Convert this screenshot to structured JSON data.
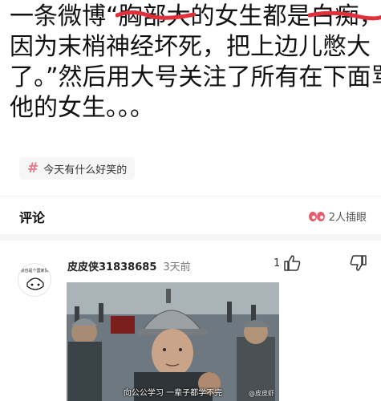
{
  "post": {
    "lines": [
      {
        "before": "一条微博“",
        "struck": "胸部大",
        "after": "的女生都是",
        "struck2": "白痴",
        "after2": "，"
      },
      {
        "text": "因为末梢神经坏死，把上边儿憋大"
      },
      {
        "text": "了。”然后用大号关注了所有在下面骂"
      },
      {
        "text": "他的女生。。。"
      }
    ]
  },
  "topic": {
    "icon": "hashtag-icon",
    "label": "今天有什么好笑的"
  },
  "comments": {
    "header": "评论",
    "insert_image_label": "2人插眼",
    "items": [
      {
        "avatar_caption": "我也是个国家队",
        "user": "皮皮侠31838685",
        "time": "3天前",
        "like_count": "1",
        "image_caption": "向公公学习 一辈子都学不完",
        "image_watermark": "@皮皮虾"
      }
    ]
  },
  "colors": {
    "scribble": "#e0303a",
    "tag_hash": "#e07a8a",
    "divider": "#f4f4f4"
  }
}
